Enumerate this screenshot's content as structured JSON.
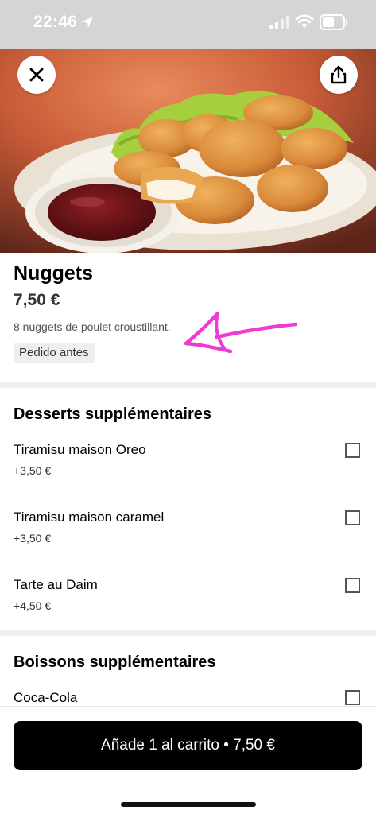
{
  "status_bar": {
    "time": "22:46"
  },
  "product": {
    "title": "Nuggets",
    "price": "7,50 €",
    "description": "8 nuggets de poulet croustillant.",
    "tag": "Pedido antes"
  },
  "sections": [
    {
      "title": "Desserts supplémentaires",
      "options": [
        {
          "name": "Tiramisu maison Oreo",
          "price": "+3,50 €",
          "checked": false
        },
        {
          "name": "Tiramisu maison caramel",
          "price": "+3,50 €",
          "checked": false
        },
        {
          "name": "Tarte au Daim",
          "price": "+4,50 €",
          "checked": false
        }
      ]
    },
    {
      "title": "Boissons supplémentaires",
      "options": [
        {
          "name": "Coca-Cola",
          "checked": false
        }
      ]
    }
  ],
  "cart_button": {
    "label": "Añade 1 al carrito • 7,50 €"
  },
  "colors": {
    "annotation": "#f03ad2",
    "button_bg": "#000000"
  }
}
